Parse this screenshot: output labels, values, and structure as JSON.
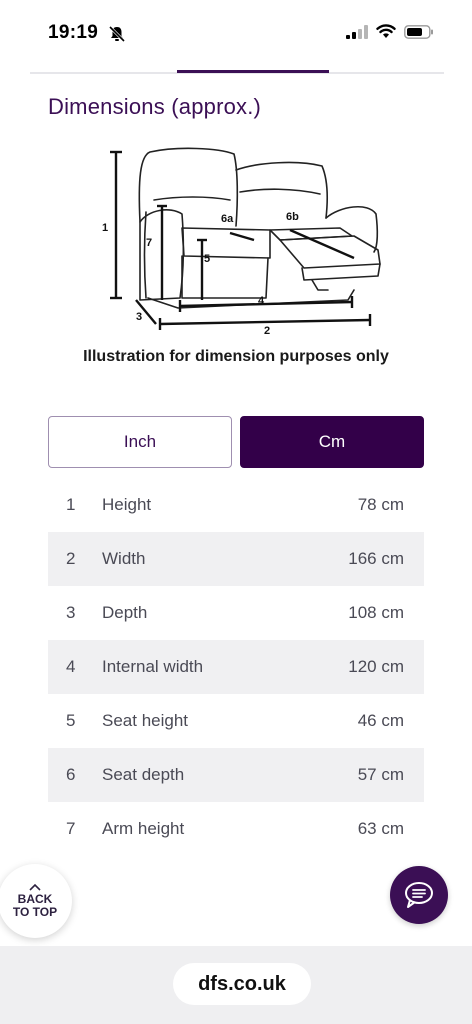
{
  "status_bar": {
    "time": "19:19",
    "icons": [
      "bell-slash-icon",
      "cellular-signal-icon",
      "wifi-icon",
      "battery-icon"
    ]
  },
  "section": {
    "title": "Dimensions (approx.)"
  },
  "illustration": {
    "labels": [
      "1",
      "7",
      "6a",
      "6b",
      "5",
      "4",
      "3",
      "2"
    ],
    "caption": "Illustration for dimension purposes only"
  },
  "unit_toggle": {
    "options": [
      "Inch",
      "Cm"
    ],
    "selected": "Cm"
  },
  "dimensions": [
    {
      "num": "1",
      "label": "Height",
      "value": "78 cm"
    },
    {
      "num": "2",
      "label": "Width",
      "value": "166 cm"
    },
    {
      "num": "3",
      "label": "Depth",
      "value": "108 cm"
    },
    {
      "num": "4",
      "label": "Internal width",
      "value": "120 cm"
    },
    {
      "num": "5",
      "label": "Seat height",
      "value": "46 cm"
    },
    {
      "num": "6",
      "label": "Seat depth",
      "value": "57 cm"
    },
    {
      "num": "7",
      "label": "Arm height",
      "value": "63 cm"
    }
  ],
  "back_to_top": {
    "line1": "BACK",
    "line2": "TO TOP"
  },
  "chat": {
    "icon": "chat-bubble-icon"
  },
  "browser": {
    "url": "dfs.co.uk"
  },
  "colors": {
    "brand_purple": "#330049",
    "accent_purple": "#3b0f55",
    "row_alt": "#f0f0f2"
  }
}
